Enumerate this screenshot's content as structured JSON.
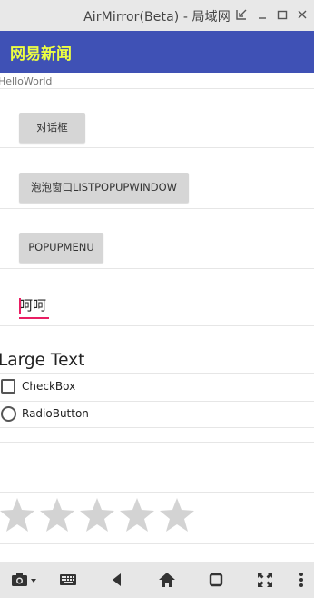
{
  "window": {
    "title": "AirMirror(Beta) - 局域网",
    "controls": [
      "shrink-icon",
      "minimize-icon",
      "maximize-icon",
      "close-icon"
    ]
  },
  "appbar": {
    "title": "网易新闻",
    "background": "#3f51b5",
    "title_color": "#eeff41"
  },
  "content": {
    "hello": "HelloWorld",
    "buttons": [
      {
        "label": "对话框"
      },
      {
        "label": "泡泡窗口LISTPOPUPWINDOW"
      },
      {
        "label": "POPUPMENU"
      }
    ],
    "edit_text": "呵呵",
    "large_text": "Large Text",
    "checkbox": {
      "label": "CheckBox",
      "checked": false
    },
    "radio": {
      "label": "RadioButton",
      "checked": false
    },
    "rating": {
      "stars": 5,
      "value": 0
    }
  },
  "accent": "#e91e63",
  "toolbar": {
    "items": [
      "camera-icon",
      "keyboard-icon",
      "back-icon",
      "home-icon",
      "recent-apps-icon",
      "fullscreen-icon",
      "more-icon"
    ]
  }
}
